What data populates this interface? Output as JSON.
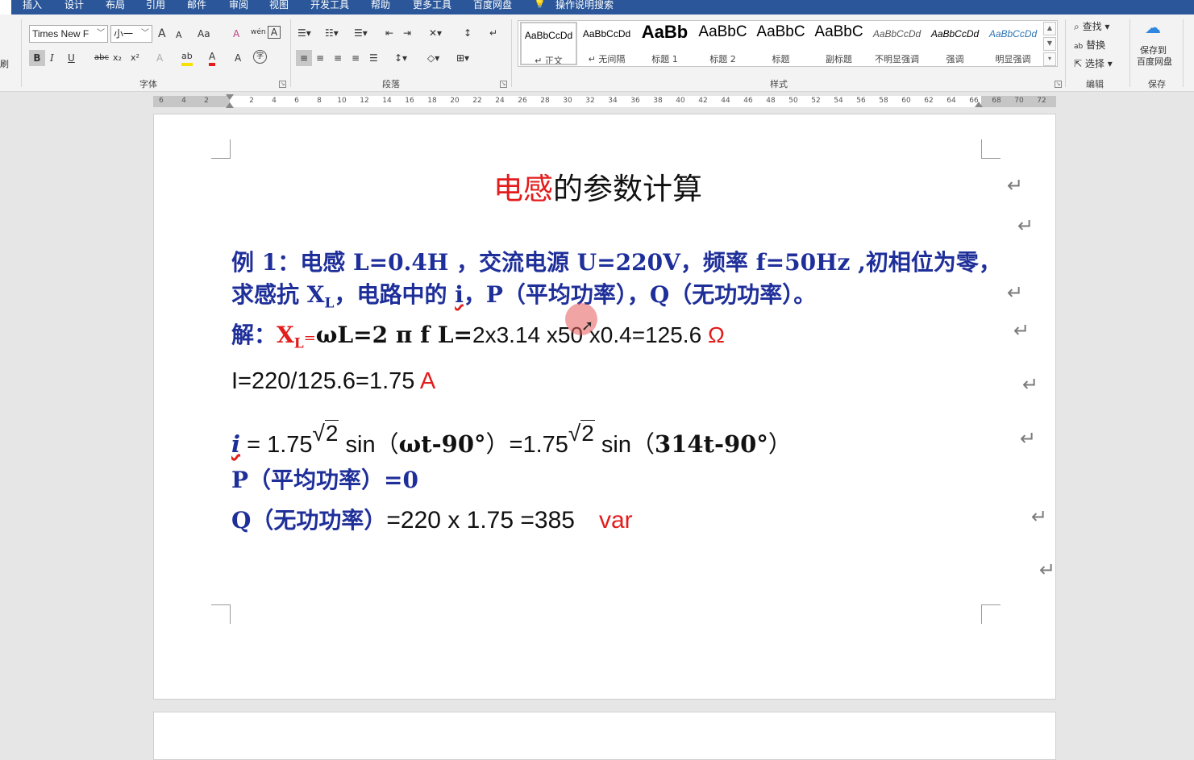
{
  "tabs": [
    "插入",
    "设计",
    "布局",
    "引用",
    "邮件",
    "审阅",
    "视图",
    "开发工具",
    "帮助",
    "更多工具",
    "百度网盘",
    "操作说明搜索"
  ],
  "ribbon": {
    "clipboard_label": "刷",
    "font": {
      "group": "字体",
      "name": "Times New F",
      "size": "小一",
      "grow": "A",
      "shrink": "A",
      "case": "Aa",
      "clear": "A",
      "phonetic": "wén",
      "border": "A",
      "bold": "B",
      "italic": "I",
      "underline": "U",
      "strike": "abc",
      "sub": "x₂",
      "sup": "x²",
      "effects": "A",
      "highlight": "ab",
      "color": "A",
      "color_hex": "#e31c1c",
      "enclose": "字"
    },
    "paragraph": {
      "group": "段落"
    },
    "styles": {
      "group": "样式",
      "items": [
        {
          "preview": "AaBbCcDd",
          "name": "↵ 正文"
        },
        {
          "preview": "AaBbCcDd",
          "name": "↵ 无间隔"
        },
        {
          "preview": "AaBb",
          "name": "标题 1"
        },
        {
          "preview": "AaBbC",
          "name": "标题 2"
        },
        {
          "preview": "AaBbC",
          "name": "标题"
        },
        {
          "preview": "AaBbC",
          "name": "副标题"
        },
        {
          "preview": "AaBbCcDd",
          "name": "不明显强调"
        },
        {
          "preview": "AaBbCcDd",
          "name": "强调"
        },
        {
          "preview": "AaBbCcDd",
          "name": "明显强调"
        }
      ]
    },
    "editing": {
      "group": "编辑",
      "find": "查找",
      "replace": "替换",
      "select": "选择"
    },
    "save": {
      "group": "保存",
      "line1": "保存到",
      "line2": "百度网盘"
    }
  },
  "ruler": {
    "numbers": [
      "6",
      "4",
      "2",
      "2",
      "4",
      "6",
      "8",
      "10",
      "12",
      "14",
      "16",
      "18",
      "20",
      "22",
      "24",
      "26",
      "28",
      "30",
      "32",
      "34",
      "36",
      "38",
      "40",
      "42",
      "44",
      "46",
      "48",
      "50",
      "52",
      "54",
      "56",
      "58",
      "60",
      "62",
      "64",
      "66",
      "68",
      "70",
      "72"
    ]
  },
  "document": {
    "title_red": "电感",
    "title_rest": "的参数计算",
    "ex1_a": "例 1：电感 L=0.4H ，交流电源 U=220V，频率 f=50Hz ,初相位为零，",
    "ex1_b1": "求感抗 X",
    "ex1_b_sub": "L",
    "ex1_b2": "，电路中的 ",
    "ex1_b_i": "i",
    "ex1_b3": "，P（平均功率），Q（无功功率）。",
    "sol_label": "解：",
    "sol_x": "X",
    "sol_sub": "L",
    "sol_eq": "=",
    "sol_formula": "ωL=2 π f L=",
    "sol_calc": "2x3.14 x50 x0.4=125.6 ",
    "sol_unit": "Ω",
    "i_line": "I=220/125.6=1.75 ",
    "i_unit": "A",
    "wave_i": "i",
    "wave_1": " = 1.75",
    "sqrt_sign": "√",
    "sqrt_arg": "2",
    "wave_2": " sin（",
    "wave_3": "ωt-90°",
    "wave_4": "）=1.75",
    "wave_5": " sin（",
    "wave_6": "314t-90°",
    "wave_7": "）",
    "p_line": "P（平均功率）=0",
    "q_label": "Q（无功功率）",
    "q_calc": "=220 x 1.75 =385",
    "q_unit": "var",
    "para_mark": "↵"
  }
}
